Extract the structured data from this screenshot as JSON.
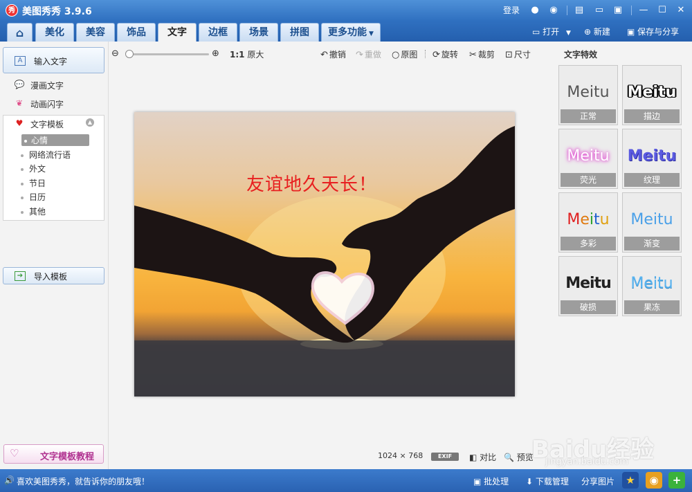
{
  "app": {
    "title": "美图秀秀 3.9.6",
    "logo_text": "秀"
  },
  "titlebar": {
    "login": "登录",
    "controls": [
      "—",
      "☐",
      "✕"
    ]
  },
  "tabs": [
    {
      "label": "⌂",
      "active": false
    },
    {
      "label": "美化",
      "active": false
    },
    {
      "label": "美容",
      "active": false
    },
    {
      "label": "饰品",
      "active": false
    },
    {
      "label": "文字",
      "active": true
    },
    {
      "label": "边框",
      "active": false
    },
    {
      "label": "场景",
      "active": false
    },
    {
      "label": "拼图",
      "active": false
    },
    {
      "label": "更多功能",
      "active": false
    }
  ],
  "file_actions": {
    "open": "打开",
    "new": "新建",
    "save_share": "保存与分享"
  },
  "left": {
    "input_text": "输入文字",
    "comic_text": "漫画文字",
    "anim_text": "动画闪字",
    "template": "文字模板",
    "template_items": [
      "心情",
      "网络流行语",
      "外文",
      "节日",
      "日历",
      "其他"
    ],
    "import_template": "导入模板",
    "tutorial": "文字模板教程"
  },
  "toolbar": {
    "original_size_ratio": "1:1",
    "original_size": "原大",
    "undo": "撤销",
    "redo": "重做",
    "original": "原图",
    "rotate": "旋转",
    "crop": "裁剪",
    "resize": "尺寸"
  },
  "photo": {
    "overlay_text": "友谊地久天长！"
  },
  "image_info": {
    "width": "1024",
    "times": "×",
    "height": "768",
    "exif": "EXIF",
    "compare": "对比",
    "preview": "预览"
  },
  "effects": {
    "title": "文字特效",
    "sample": "Meitu",
    "items": [
      {
        "label": "正常"
      },
      {
        "label": "描边"
      },
      {
        "label": "荧光"
      },
      {
        "label": "纹理"
      },
      {
        "label": "多彩"
      },
      {
        "label": "渐变"
      },
      {
        "label": "破损"
      },
      {
        "label": "果冻"
      }
    ]
  },
  "statusbar": {
    "message": "喜欢美图秀秀，就告诉你的朋友哦！",
    "batch": "批处理",
    "download": "下载管理",
    "share_photo": "分享图片"
  },
  "watermark": {
    "logo": "Baidu经验",
    "url": "jingyan.baidu.com"
  },
  "colors": {
    "accent": "#2f70c0",
    "overlay_text": "#e82020",
    "tutorial": "#b03290"
  }
}
